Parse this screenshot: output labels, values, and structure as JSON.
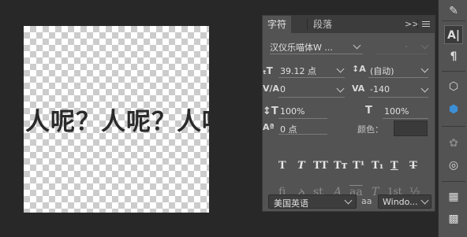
{
  "document": {
    "text": "人呢？人呢？人呢"
  },
  "panel": {
    "tabs": [
      {
        "label": "字符"
      },
      {
        "label": "段落"
      }
    ],
    "menu_icon": "panel-menu-icon",
    "collapse_icon": "double-chevron-icon",
    "font_family": "汉仪乐喵体W ...",
    "font_style": "-",
    "font_size": "39.12 点",
    "leading": "(自动)",
    "kerning": "0",
    "tracking": "-140",
    "vertical_scale": "100%",
    "horizontal_scale": "100%",
    "baseline_shift": "0 点",
    "color_label": "颜色：",
    "color_value": "#3a3a3a",
    "style_buttons": [
      {
        "name": "faux-bold",
        "glyph": "T"
      },
      {
        "name": "faux-italic",
        "glyph": "T"
      },
      {
        "name": "all-caps",
        "glyph": "TT"
      },
      {
        "name": "small-caps",
        "glyph": "Tт"
      },
      {
        "name": "superscript",
        "glyph": "T¹"
      },
      {
        "name": "subscript",
        "glyph": "T₁"
      },
      {
        "name": "underline",
        "glyph": "T"
      },
      {
        "name": "strikethrough",
        "glyph": "T"
      }
    ],
    "opentype_buttons": [
      {
        "name": "ligatures",
        "glyph": "fi"
      },
      {
        "name": "discretionary-ligatures",
        "glyph": "ꝺ"
      },
      {
        "name": "stylistic-alternates",
        "glyph": "st"
      },
      {
        "name": "swash",
        "glyph": "A"
      },
      {
        "name": "titling-alternates",
        "glyph": "aa"
      },
      {
        "name": "ordinals",
        "glyph": "T"
      },
      {
        "name": "ordinal-st",
        "glyph": "1st"
      },
      {
        "name": "fractions",
        "glyph": "½"
      }
    ],
    "language": "美国英语",
    "antialias_icon": "aa",
    "antialias": "Windo..."
  }
}
